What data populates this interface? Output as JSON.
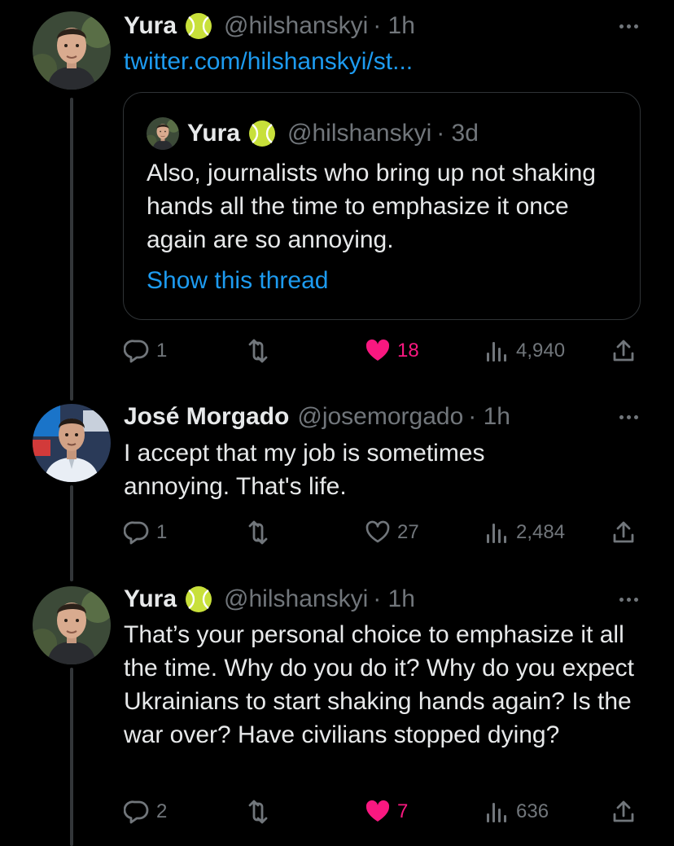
{
  "colors": {
    "background": "#000000",
    "text": "#e7e9ea",
    "muted": "#71767b",
    "link": "#1d9bf0",
    "like": "#f91880",
    "border": "#2f3336"
  },
  "tweets": [
    {
      "name": "Yura",
      "badge_icon": "tennis-ball-icon",
      "handle": "@hilshanskyi",
      "time": "· 1h",
      "link_text": "twitter.com/hilshanskyi/st...",
      "quote": {
        "name": "Yura",
        "handle": "@hilshanskyi",
        "time": "· 3d",
        "text": "Also, journalists who bring up not shaking hands all the time to emphasize it once again are so annoying.",
        "show_thread": "Show this thread"
      },
      "replies": "1",
      "likes": "18",
      "liked": true,
      "views": "4,940"
    },
    {
      "name": "José Morgado",
      "handle": "@josemorgado",
      "time": "· 1h",
      "text": "I accept that my job is sometimes annoying. That's life.",
      "replies": "1",
      "likes": "27",
      "liked": false,
      "views": "2,484"
    },
    {
      "name": "Yura",
      "badge_icon": "tennis-ball-icon",
      "handle": "@hilshanskyi",
      "time": "· 1h",
      "text": "That’s your personal choice to emphasize it all the time. Why do you do it? Why do you expect Ukrainians to start shaking hands again? Is the war over? Have civilians stopped dying?",
      "replies": "2",
      "likes": "7",
      "liked": true,
      "views": "636"
    }
  ]
}
